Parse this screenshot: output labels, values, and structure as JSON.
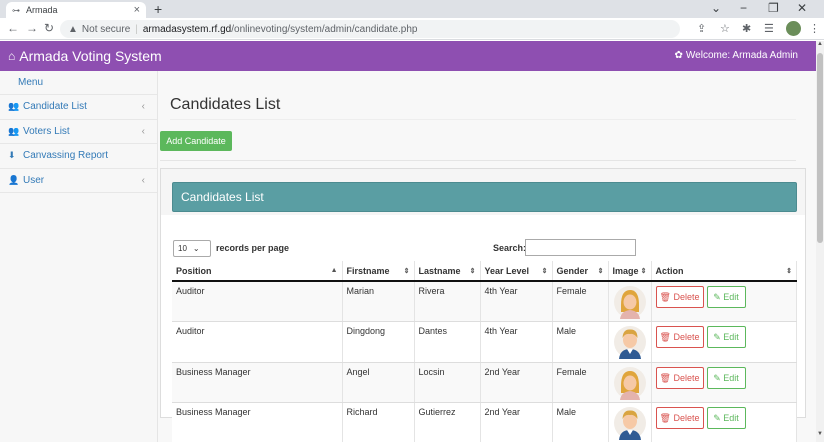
{
  "browser": {
    "tab_title": "Armada",
    "tab_close": "×",
    "new_tab": "+",
    "not_secure": "Not secure",
    "url_host": "armadasystem.rf.gd",
    "url_path": "/onlinevoting/system/admin/candidate.php"
  },
  "header": {
    "brand": "Armada Voting System",
    "welcome": "Welcome: Armada Admin"
  },
  "sidebar": {
    "menu_title": "Menu",
    "items": [
      {
        "label": "Candidate List",
        "icon": "users-icon",
        "has_submenu": true
      },
      {
        "label": "Voters List",
        "icon": "users-icon",
        "has_submenu": true
      },
      {
        "label": "Canvassing Report",
        "icon": "download-icon",
        "has_submenu": false
      },
      {
        "label": "User",
        "icon": "user-icon",
        "has_submenu": true
      }
    ]
  },
  "main": {
    "page_title": "Candidates List",
    "add_button": "Add Candidate",
    "panel_title": "Candidates List",
    "length_value": "10",
    "length_label": "records per page",
    "search_label": "Search:",
    "columns": [
      "Position",
      "Firstname",
      "Lastname",
      "Year Level",
      "Gender",
      "Image",
      "Action"
    ],
    "delete_label": "Delete",
    "edit_label": "Edit",
    "rows": [
      {
        "position": "Auditor",
        "firstname": "Marian",
        "lastname": "Rivera",
        "year": "4th Year",
        "gender": "Female",
        "avatar": "female-avatar"
      },
      {
        "position": "Auditor",
        "firstname": "Dingdong",
        "lastname": "Dantes",
        "year": "4th Year",
        "gender": "Male",
        "avatar": "male-avatar"
      },
      {
        "position": "Business Manager",
        "firstname": "Angel",
        "lastname": "Locsin",
        "year": "2nd Year",
        "gender": "Female",
        "avatar": "female-avatar"
      },
      {
        "position": "Business Manager",
        "firstname": "Richard",
        "lastname": "Gutierrez",
        "year": "2nd Year",
        "gender": "Male",
        "avatar": "male-avatar"
      }
    ]
  },
  "colors": {
    "header": "#8e4fb1",
    "panel_heading": "#5a9ea3",
    "success": "#5cb85c",
    "danger": "#d9534f",
    "link": "#337ab7"
  }
}
